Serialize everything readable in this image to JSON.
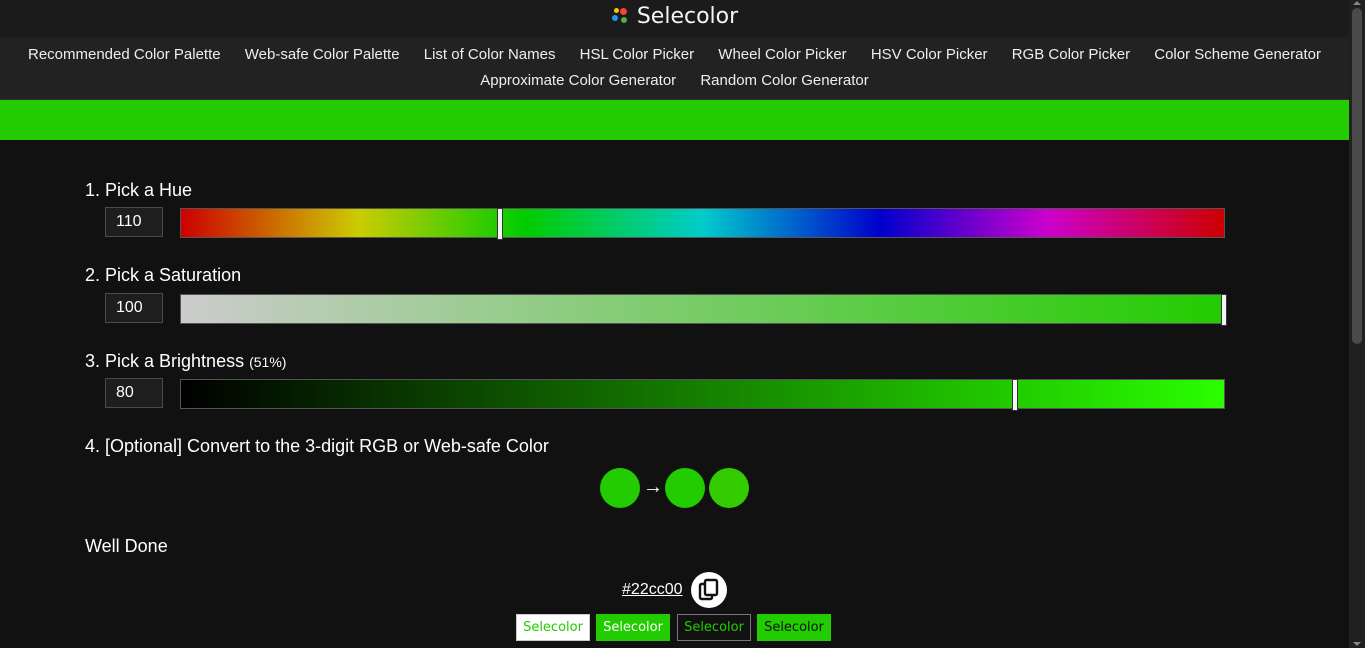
{
  "brand": {
    "name": "Selecolor",
    "logo_colors": [
      "#2196f3",
      "#f44336",
      "#ffc107",
      "#4caf50"
    ]
  },
  "nav": {
    "row1": [
      "Recommended Color Palette",
      "Web-safe Color Palette",
      "List of Color Names",
      "HSL Color Picker",
      "Wheel Color Picker",
      "HSV Color Picker",
      "RGB Color Picker",
      "Color Scheme Generator"
    ],
    "row2": [
      "Approximate Color Generator",
      "Random Color Generator"
    ]
  },
  "colors": {
    "selected": "#22cc00",
    "background": "#111111",
    "header": "#1b1b1b",
    "nav": "#222222"
  },
  "hue": {
    "title": "1. Pick a Hue",
    "value": "110",
    "fraction": 0.3056
  },
  "saturation": {
    "title": "2. Pick a Saturation",
    "value": "100",
    "fraction": 1.0
  },
  "brightness": {
    "title": "3. Pick a Brightness",
    "note": "(51%)",
    "value": "80",
    "fraction": 0.8
  },
  "convert": {
    "title": "4. [Optional] Convert to the 3-digit RGB or Web-safe Color",
    "arrow": "→",
    "swatches": [
      "#22cc00",
      "#22cc00",
      "#33cc00"
    ]
  },
  "result": {
    "title": "Well Done",
    "hex": "#22cc00",
    "copy_icon": "copy-icon"
  },
  "samples": [
    {
      "label": "Selecolor",
      "bg": "#ffffff",
      "fg": "#22cc00",
      "border": "#cccccc"
    },
    {
      "label": "Selecolor",
      "bg": "#22cc00",
      "fg": "#ffffff",
      "border": "#22cc00"
    },
    {
      "label": "Selecolor",
      "bg": "#111111",
      "fg": "#22cc00",
      "border": "#777777"
    },
    {
      "label": "Selecolor",
      "bg": "#22cc00",
      "fg": "#111111",
      "border": "#22cc00"
    }
  ]
}
